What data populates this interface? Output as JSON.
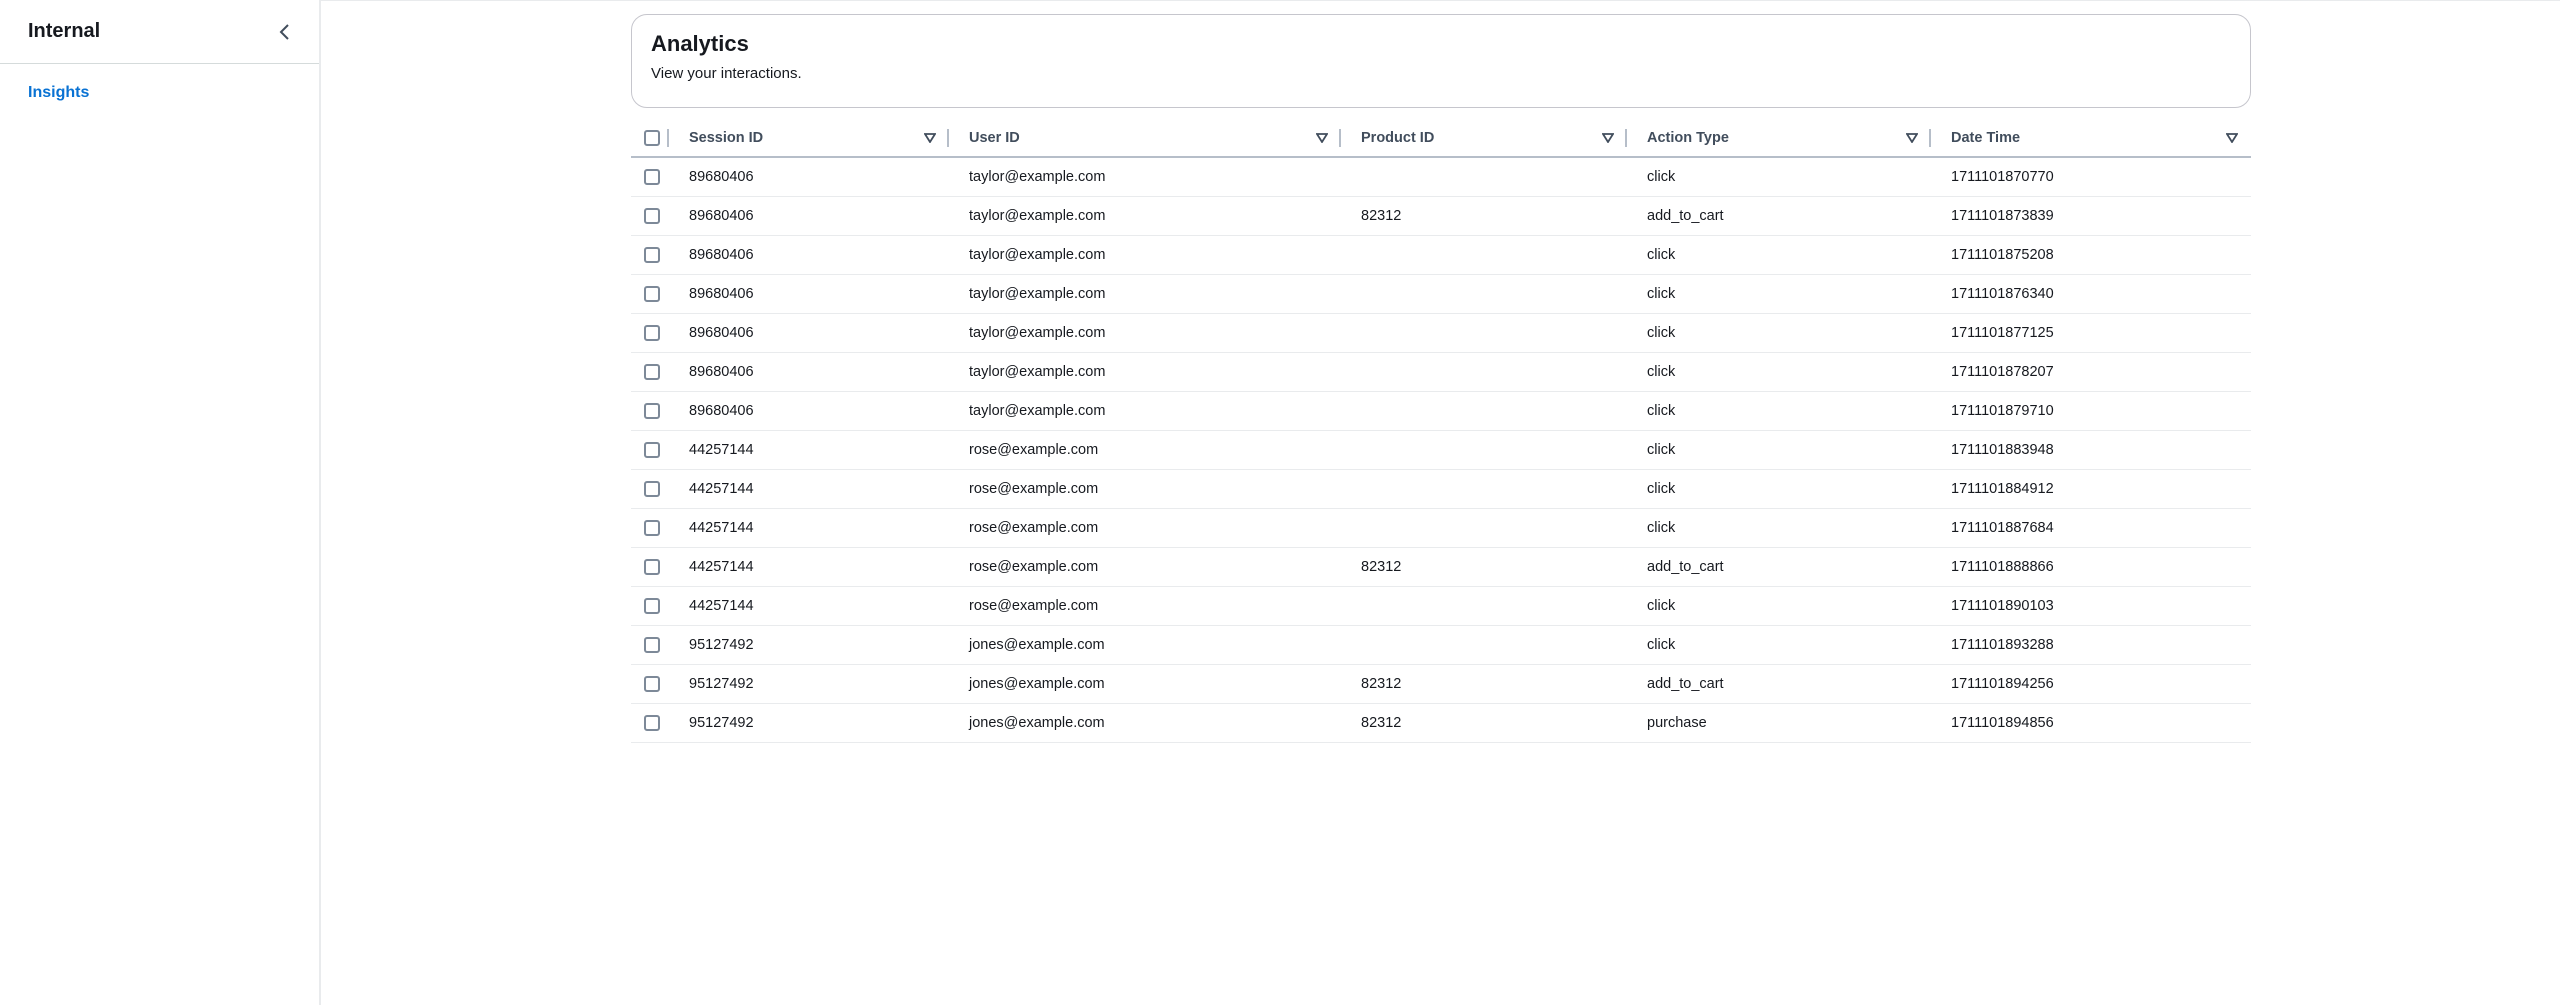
{
  "sidebar": {
    "title": "Internal",
    "items": [
      {
        "label": "Insights"
      }
    ]
  },
  "header": {
    "title": "Analytics",
    "description": "View your interactions."
  },
  "table": {
    "columns": [
      "Session ID",
      "User ID",
      "Product ID",
      "Action Type",
      "Date Time"
    ],
    "rows": [
      [
        "89680406",
        "taylor@example.com",
        "",
        "click",
        "1711101870770"
      ],
      [
        "89680406",
        "taylor@example.com",
        "82312",
        "add_to_cart",
        "1711101873839"
      ],
      [
        "89680406",
        "taylor@example.com",
        "",
        "click",
        "1711101875208"
      ],
      [
        "89680406",
        "taylor@example.com",
        "",
        "click",
        "1711101876340"
      ],
      [
        "89680406",
        "taylor@example.com",
        "",
        "click",
        "1711101877125"
      ],
      [
        "89680406",
        "taylor@example.com",
        "",
        "click",
        "1711101878207"
      ],
      [
        "89680406",
        "taylor@example.com",
        "",
        "click",
        "1711101879710"
      ],
      [
        "44257144",
        "rose@example.com",
        "",
        "click",
        "1711101883948"
      ],
      [
        "44257144",
        "rose@example.com",
        "",
        "click",
        "1711101884912"
      ],
      [
        "44257144",
        "rose@example.com",
        "",
        "click",
        "1711101887684"
      ],
      [
        "44257144",
        "rose@example.com",
        "82312",
        "add_to_cart",
        "1711101888866"
      ],
      [
        "44257144",
        "rose@example.com",
        "",
        "click",
        "1711101890103"
      ],
      [
        "95127492",
        "jones@example.com",
        "",
        "click",
        "1711101893288"
      ],
      [
        "95127492",
        "jones@example.com",
        "82312",
        "add_to_cart",
        "1711101894256"
      ],
      [
        "95127492",
        "jones@example.com",
        "82312",
        "purchase",
        "1711101894856"
      ]
    ]
  },
  "colors": {
    "link": "#0972d3",
    "text": "#16191f",
    "header_text": "#414d5c",
    "border": "#e9ebed"
  },
  "icons": {
    "collapse": "chevron-left-icon",
    "sort": "sort-caret-down-icon"
  }
}
